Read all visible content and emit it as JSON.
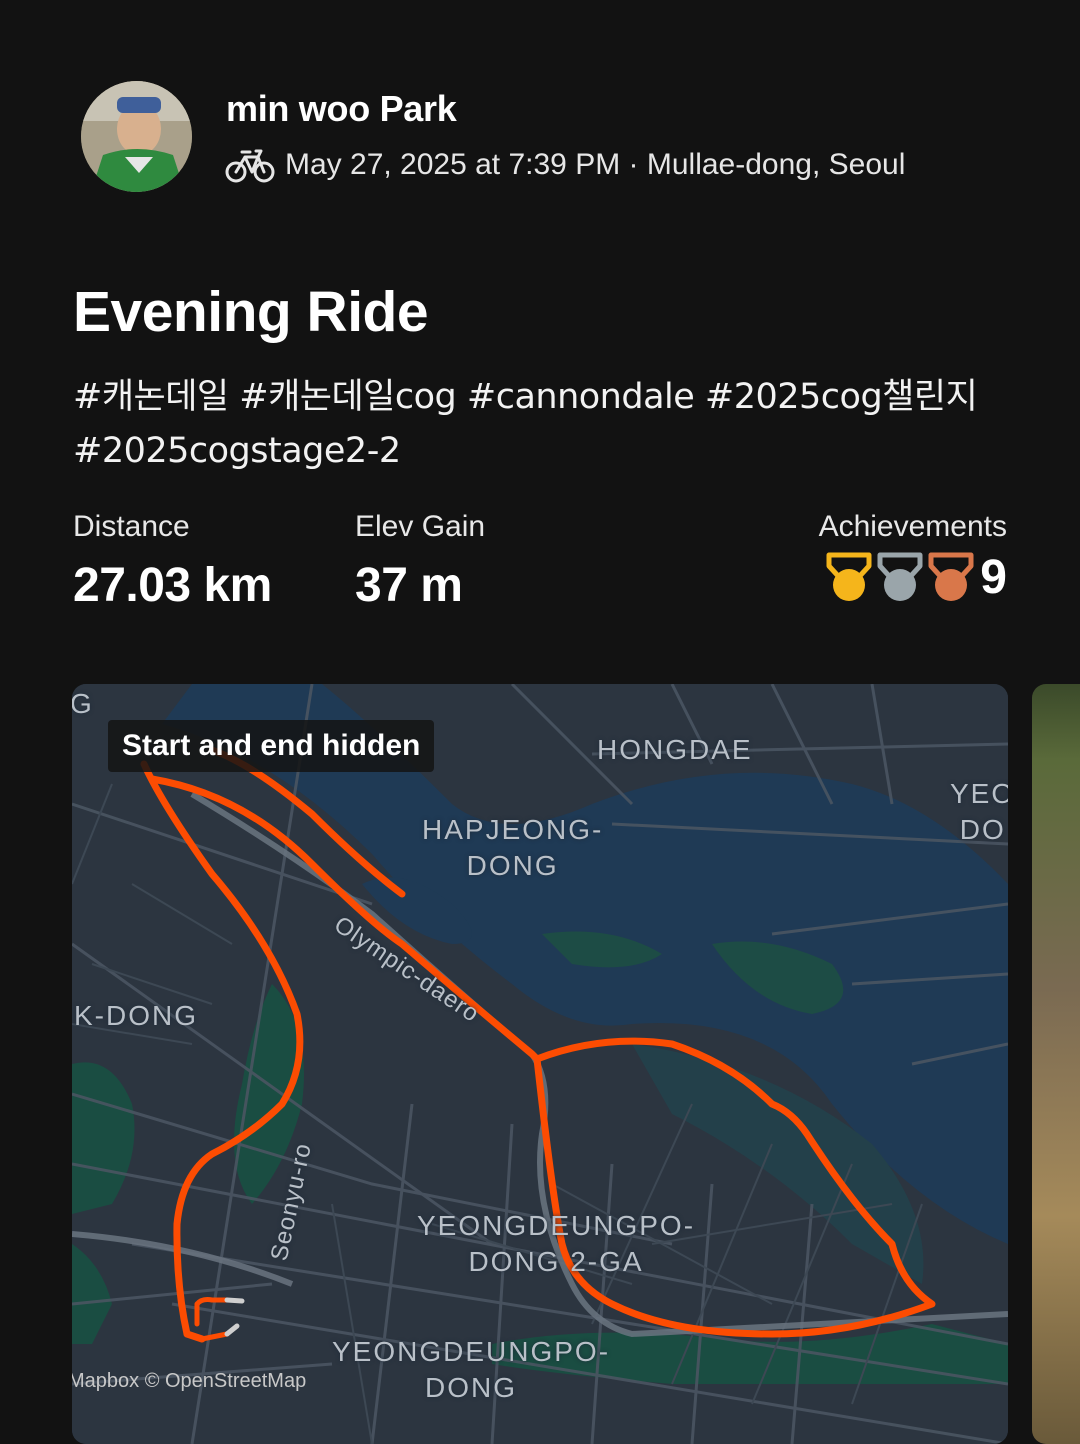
{
  "activity": {
    "athlete_name": "min woo Park",
    "activity_type_icon": "bike-icon",
    "meta": "May 27, 2025 at 7:39 PM · Mullae-dong, Seoul",
    "title": "Evening Ride",
    "description": "#캐논데일 #캐논데일cog #cannondale #2025cog챌린지 #2025cogstage2-2"
  },
  "stats": {
    "distance": {
      "label": "Distance",
      "value": "27.03 km"
    },
    "elev_gain": {
      "label": "Elev Gain",
      "value": "37 m"
    },
    "achievements": {
      "label": "Achievements",
      "count": "9",
      "medals": [
        {
          "icon": "gold-medal-icon",
          "color": "#F5B51B"
        },
        {
          "icon": "silver-medal-icon",
          "color": "#9AA5AA"
        },
        {
          "icon": "bronze-medal-icon",
          "color": "#D9774A"
        }
      ]
    }
  },
  "map": {
    "badge": "Start and end hidden",
    "labels": {
      "hongdae": "HONGDAE",
      "hapjeong": "HAPJEONG-\nDONG",
      "yeo": "YEO\nDO",
      "kdong": "K-DONG",
      "olympic": "Olympic-daero",
      "seonyu": "Seonyu-ro",
      "ydp_2ga": "YEONGDEUNGPO-\nDONG 2-GA",
      "ydp": "YEONGDEUNGPO-\nDONG",
      "g": "G"
    },
    "attribution": "Mapbox © OpenStreetMap",
    "route_color": "#FC4C02",
    "water_color": "#1F3A55",
    "land_color": "#2C3540"
  }
}
